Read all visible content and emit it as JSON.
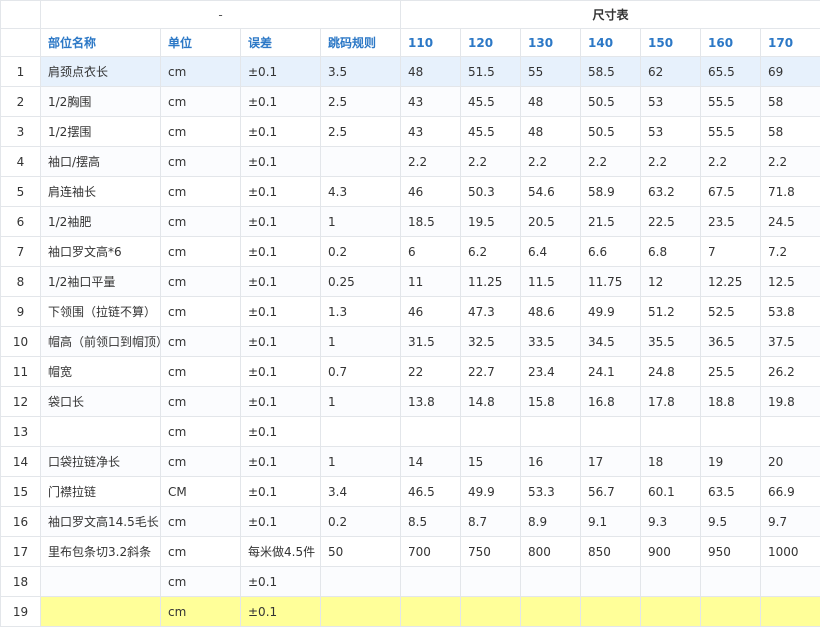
{
  "group_headers": {
    "left": "-",
    "right": "尺寸表"
  },
  "columns": [
    "部位名称",
    "单位",
    "误差",
    "跳码规则",
    "110",
    "120",
    "130",
    "140",
    "150",
    "160",
    "170"
  ],
  "rows": [
    {
      "no": "1",
      "cells": [
        "肩颈点衣长",
        "cm",
        "±0.1",
        "3.5",
        "48",
        "51.5",
        "55",
        "58.5",
        "62",
        "65.5",
        "69"
      ]
    },
    {
      "no": "2",
      "cells": [
        "1/2胸围",
        "cm",
        "±0.1",
        "2.5",
        "43",
        "45.5",
        "48",
        "50.5",
        "53",
        "55.5",
        "58"
      ]
    },
    {
      "no": "3",
      "cells": [
        "1/2摆围",
        "cm",
        "±0.1",
        "2.5",
        "43",
        "45.5",
        "48",
        "50.5",
        "53",
        "55.5",
        "58"
      ]
    },
    {
      "no": "4",
      "cells": [
        "袖口/摆高",
        "cm",
        "±0.1",
        "",
        "2.2",
        "2.2",
        "2.2",
        "2.2",
        "2.2",
        "2.2",
        "2.2"
      ]
    },
    {
      "no": "5",
      "cells": [
        "肩连袖长",
        "cm",
        "±0.1",
        "4.3",
        "46",
        "50.3",
        "54.6",
        "58.9",
        "63.2",
        "67.5",
        "71.8"
      ]
    },
    {
      "no": "6",
      "cells": [
        "1/2袖肥",
        "cm",
        "±0.1",
        "1",
        "18.5",
        "19.5",
        "20.5",
        "21.5",
        "22.5",
        "23.5",
        "24.5"
      ]
    },
    {
      "no": "7",
      "cells": [
        "袖口罗文高*6",
        "cm",
        "±0.1",
        "0.2",
        "6",
        "6.2",
        "6.4",
        "6.6",
        "6.8",
        "7",
        "7.2"
      ]
    },
    {
      "no": "8",
      "cells": [
        "1/2袖口平量",
        "cm",
        "±0.1",
        "0.25",
        "11",
        "11.25",
        "11.5",
        "11.75",
        "12",
        "12.25",
        "12.5"
      ]
    },
    {
      "no": "9",
      "cells": [
        "下领围（拉链不算）",
        "cm",
        "±0.1",
        "1.3",
        "46",
        "47.3",
        "48.6",
        "49.9",
        "51.2",
        "52.5",
        "53.8"
      ]
    },
    {
      "no": "10",
      "cells": [
        "帽高（前领口到帽顶）",
        "cm",
        "±0.1",
        "1",
        "31.5",
        "32.5",
        "33.5",
        "34.5",
        "35.5",
        "36.5",
        "37.5"
      ]
    },
    {
      "no": "11",
      "cells": [
        "帽宽",
        "cm",
        "±0.1",
        "0.7",
        "22",
        "22.7",
        "23.4",
        "24.1",
        "24.8",
        "25.5",
        "26.2"
      ]
    },
    {
      "no": "12",
      "cells": [
        "袋口长",
        "cm",
        "±0.1",
        "1",
        "13.8",
        "14.8",
        "15.8",
        "16.8",
        "17.8",
        "18.8",
        "19.8"
      ]
    },
    {
      "no": "13",
      "cells": [
        "",
        "cm",
        "±0.1",
        "",
        "",
        "",
        "",
        "",
        "",
        "",
        ""
      ]
    },
    {
      "no": "14",
      "cells": [
        "口袋拉链净长",
        "cm",
        "±0.1",
        "1",
        "14",
        "15",
        "16",
        "17",
        "18",
        "19",
        "20"
      ]
    },
    {
      "no": "15",
      "cells": [
        "门襟拉链",
        "CM",
        "±0.1",
        "3.4",
        "46.5",
        "49.9",
        "53.3",
        "56.7",
        "60.1",
        "63.5",
        "66.9"
      ]
    },
    {
      "no": "16",
      "cells": [
        "袖口罗文高14.5毛长",
        "cm",
        "±0.1",
        "0.2",
        "8.5",
        "8.7",
        "8.9",
        "9.1",
        "9.3",
        "9.5",
        "9.7"
      ]
    },
    {
      "no": "17",
      "cells": [
        "里布包条切3.2斜条",
        "cm",
        "每米做4.5件",
        "50",
        "700",
        "750",
        "800",
        "850",
        "900",
        "950",
        "1000"
      ]
    },
    {
      "no": "18",
      "cells": [
        "",
        "cm",
        "±0.1",
        "",
        "",
        "",
        "",
        "",
        "",
        "",
        ""
      ]
    },
    {
      "no": "19",
      "cells": [
        "",
        "cm",
        "±0.1",
        "",
        "",
        "",
        "",
        "",
        "",
        "",
        ""
      ]
    }
  ],
  "colors": {
    "header_text": "#2c78c6",
    "selected_row": "#e7f1fc",
    "highlight_row": "#ffff99",
    "grid": "#e3e6ea"
  }
}
